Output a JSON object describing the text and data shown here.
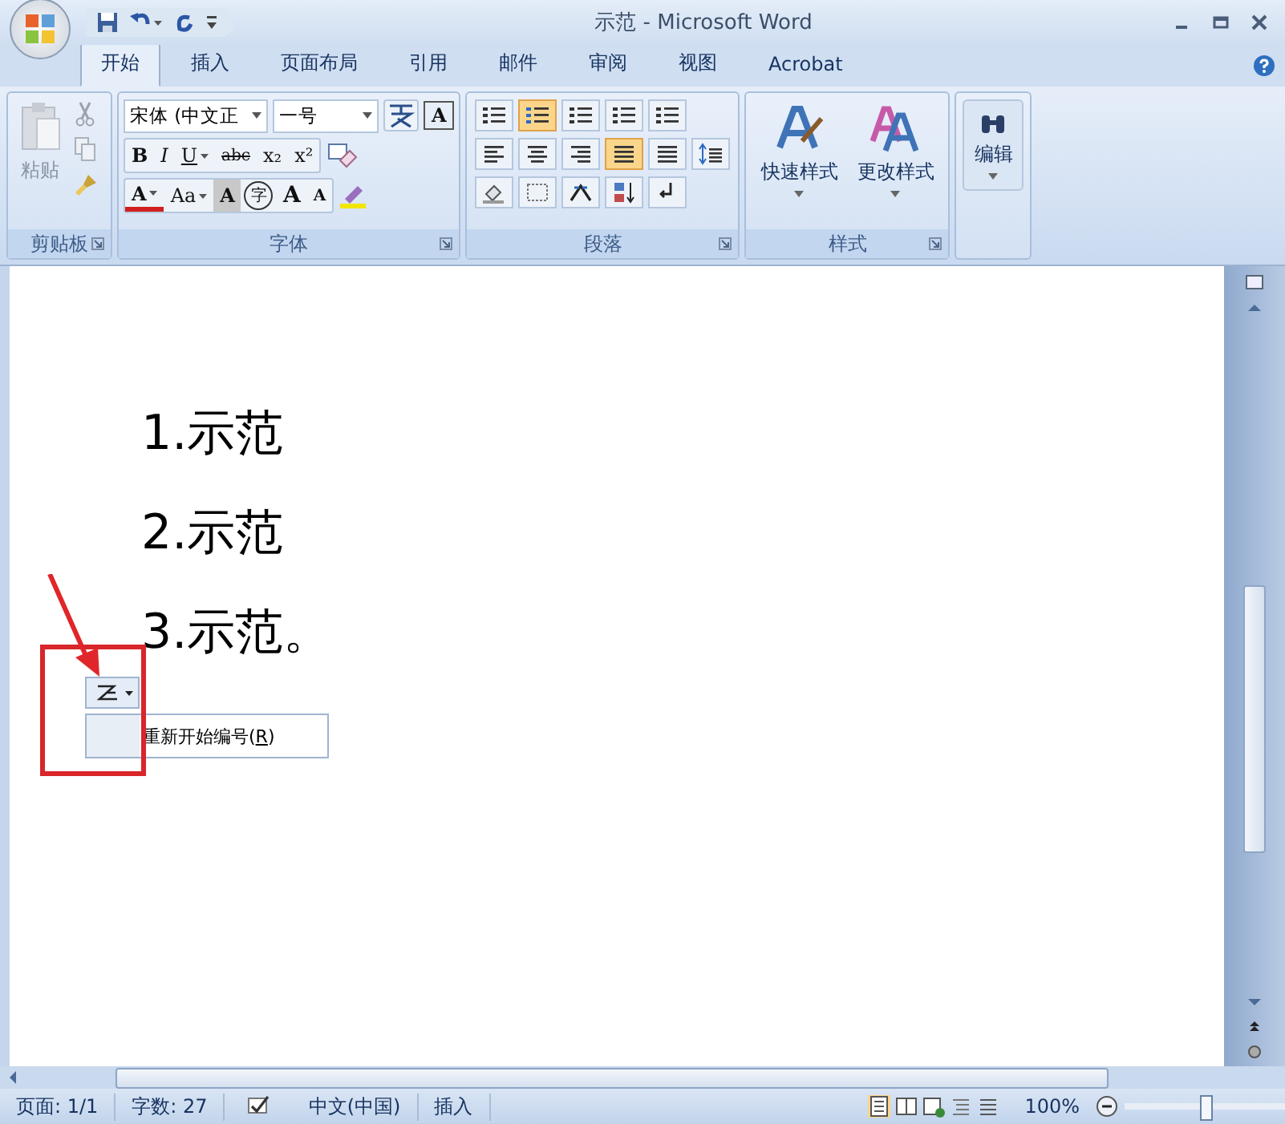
{
  "window": {
    "title": "示范 - Microsoft Word"
  },
  "tabs": [
    {
      "label": "开始",
      "selected": true
    },
    {
      "label": "插入",
      "selected": false
    },
    {
      "label": "页面布局",
      "selected": false
    },
    {
      "label": "引用",
      "selected": false
    },
    {
      "label": "邮件",
      "selected": false
    },
    {
      "label": "审阅",
      "selected": false
    },
    {
      "label": "视图",
      "selected": false
    },
    {
      "label": "Acrobat",
      "selected": false
    }
  ],
  "ribbon": {
    "clipboard": {
      "label": "剪贴板",
      "paste": "粘贴"
    },
    "font": {
      "label": "字体",
      "font_name": "宋体 (中文正",
      "font_size": "一号",
      "top_buttons": [
        {
          "glyph": "A",
          "kind": "boxed",
          "dropdown": false
        }
      ],
      "middle_buttons": [
        {
          "glyph": "B",
          "kind": "bold",
          "dropdown": false
        },
        {
          "glyph": "I",
          "kind": "italic",
          "dropdown": false
        },
        {
          "glyph": "U",
          "kind": "underline",
          "dropdown": true
        },
        {
          "glyph": "abc",
          "kind": "strike",
          "dropdown": false
        },
        {
          "glyph": "x₂",
          "kind": "plain",
          "dropdown": false
        },
        {
          "glyph": "x²",
          "kind": "plain",
          "dropdown": false
        }
      ],
      "bottom_buttons": [
        {
          "glyph": "A",
          "kind": "color",
          "dropdown": true
        },
        {
          "glyph": "Aa",
          "kind": "plain",
          "dropdown": true
        },
        {
          "glyph": "A",
          "kind": "shaded",
          "dropdown": false
        },
        {
          "glyph": "字",
          "kind": "circled",
          "dropdown": false
        },
        {
          "glyph": "A",
          "kind": "grow",
          "dropdown": false
        },
        {
          "glyph": "A",
          "kind": "shrink",
          "dropdown": false
        }
      ]
    },
    "paragraph": {
      "label": "段落",
      "rows": [
        [
          {
            "kind": "bullets",
            "selected": false
          },
          {
            "kind": "numbering",
            "selected": true
          },
          {
            "kind": "multilevel",
            "selected": false
          },
          {
            "kind": "decrease-indent",
            "selected": false
          },
          {
            "kind": "increase-indent",
            "selected": false
          }
        ],
        [
          {
            "kind": "align-left",
            "selected": false
          },
          {
            "kind": "align-center",
            "selected": false
          },
          {
            "kind": "align-right",
            "selected": false
          },
          {
            "kind": "justify",
            "selected": true
          },
          {
            "kind": "distributed",
            "selected": false
          },
          {
            "kind": "line-spacing",
            "selected": false
          }
        ],
        [
          {
            "kind": "shading",
            "selected": false
          },
          {
            "kind": "borders",
            "selected": false
          },
          {
            "kind": "asian-layout",
            "selected": false
          },
          {
            "kind": "sort",
            "selected": false
          },
          {
            "kind": "marks",
            "selected": false
          }
        ]
      ]
    },
    "styles": {
      "label": "样式",
      "quick_styles": "快速样式",
      "change_styles": "更改样式"
    },
    "editing": {
      "label": "编辑"
    }
  },
  "document": {
    "list_items": [
      "1.示范",
      "2.示范",
      "3.示范。"
    ],
    "autocorrect_menu": {
      "label": "重新开始编号(",
      "mnemonic": "R",
      "label_end": ")"
    }
  },
  "status_bar": {
    "page": "页面: 1/1",
    "word_count": "字数: 27",
    "language": "中文(中国)",
    "mode": "插入",
    "zoom": "100%",
    "zoom_slider": {
      "level": 0.5
    }
  }
}
